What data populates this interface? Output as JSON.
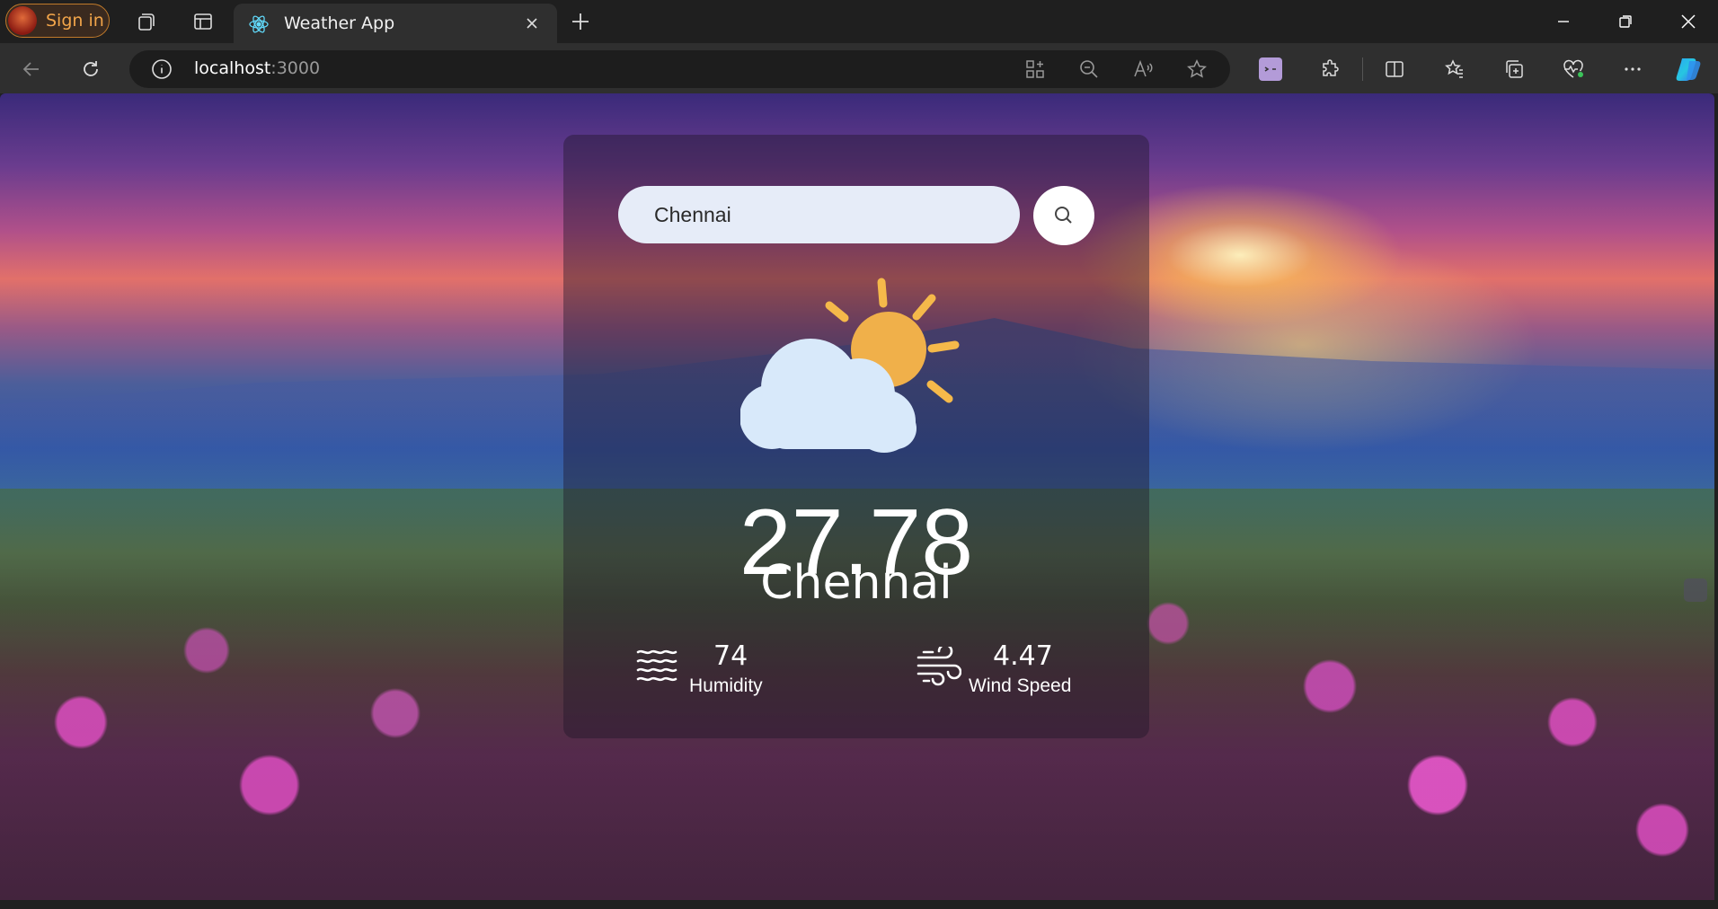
{
  "browser": {
    "profile_button": "Sign in",
    "tab_title": "Weather App",
    "address": {
      "host": "localhost",
      "port": ":3000"
    },
    "icons": [
      "workspaces-icon",
      "tab-actions-icon",
      "react-favicon",
      "close-tab-icon",
      "new-tab-icon",
      "minimize-icon",
      "restore-icon",
      "close-window-icon",
      "back-icon",
      "refresh-icon",
      "site-info-icon",
      "app-available-icon",
      "zoom-out-icon",
      "read-aloud-icon",
      "favorite-icon",
      "extension-icon",
      "extensions-icon",
      "split-screen-icon",
      "favorites-icon",
      "collections-icon",
      "browser-essentials-icon",
      "more-icon",
      "copilot-icon"
    ]
  },
  "weather": {
    "search_value": "Chennai",
    "temperature": "27.78",
    "city": "Chennai",
    "humidity": {
      "value": "74",
      "label": "Humidity"
    },
    "wind": {
      "value": "4.47",
      "label": "Wind Speed"
    },
    "condition_icon": "partly-cloudy-icon"
  }
}
